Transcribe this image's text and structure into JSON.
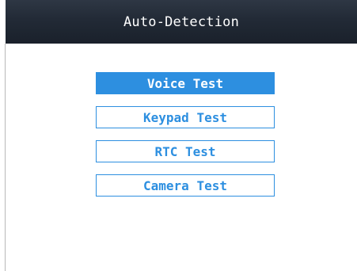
{
  "header": {
    "title": "Auto-Detection"
  },
  "menu": {
    "items": [
      {
        "label": "Voice Test",
        "selected": true
      },
      {
        "label": "Keypad Test",
        "selected": false
      },
      {
        "label": "RTC Test",
        "selected": false
      },
      {
        "label": "Camera Test",
        "selected": false
      }
    ]
  },
  "colors": {
    "accent": "#2d8fe0",
    "title_bar": "#222a36",
    "background": "#ffffff"
  }
}
